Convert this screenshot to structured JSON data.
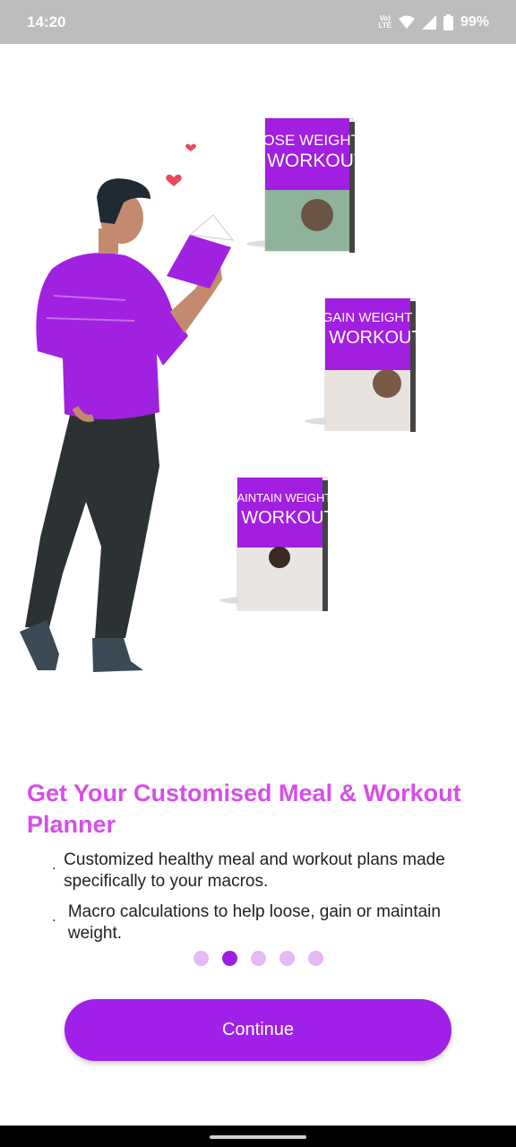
{
  "status": {
    "time": "14:20",
    "network": "Vo) LTE",
    "battery": "99%"
  },
  "books": [
    {
      "title_line1": "LOSE WEIGHT",
      "title_line2": "& WORKOUT"
    },
    {
      "title_line1": "GAIN WEIGHT",
      "title_line2": "& WORKOUT"
    },
    {
      "title_line1": "MAINTAIN WEIGHT",
      "title_line2": "& WORKOUT"
    }
  ],
  "onboarding": {
    "title": "Get Your Customised Meal & Workout Planner",
    "bullets": [
      "Customized healthy meal and workout plans made specifically to your macros.",
      "Macro calculations to help loose, gain or maintain weight."
    ],
    "bullet_marker": ".",
    "pages_total": 5,
    "current_page": 2
  },
  "actions": {
    "continue_label": "Continue"
  },
  "colors": {
    "accent": "#a020ea",
    "title": "#d64ee8",
    "dot_inactive": "#e5b8f6"
  }
}
